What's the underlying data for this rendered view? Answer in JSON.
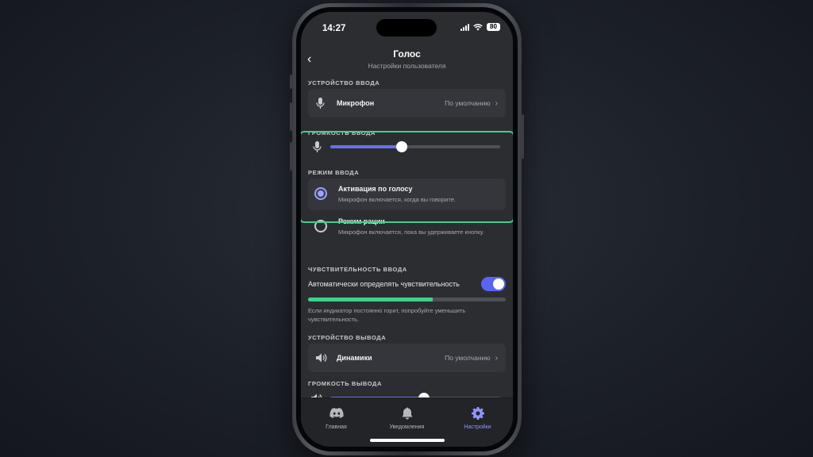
{
  "status_bar": {
    "time": "14:27",
    "battery": "80"
  },
  "header": {
    "title": "Голос",
    "subtitle": "Настройки пользователя"
  },
  "input_device": {
    "section_label": "УСТРОЙСТВО ВВОДА",
    "label": "Микрофон",
    "value": "По умолчанию",
    "icon": "microphone-icon"
  },
  "input_volume": {
    "section_label": "ГРОМКОСТЬ ВВОДА",
    "level": 0.42,
    "icon": "microphone-icon"
  },
  "input_mode": {
    "section_label": "РЕЖИМ ВВОДА",
    "options": [
      {
        "title": "Активация по голосу",
        "description": "Микрофон включается, когда вы говорите.",
        "selected": true
      },
      {
        "title": "Режим рации",
        "description": "Микрофон включается, пока вы удерживаете кнопку.",
        "selected": false
      }
    ],
    "highlight_color": "#3bd28a"
  },
  "input_sensitivity": {
    "section_label": "ЧУВСТВИТЕЛЬНОСТЬ ВВОДА",
    "toggle_label": "Автоматически определять чувствительность",
    "toggle_on": true,
    "level": 0.63,
    "hint": "Если индикатор постоянно горит, попробуйте уменьшить чувствительность."
  },
  "output_device": {
    "section_label": "УСТРОЙСТВО ВЫВОДА",
    "label": "Динамики",
    "value": "По умолчанию",
    "icon": "speaker-icon"
  },
  "output_volume": {
    "section_label": "ГРОМКОСТЬ ВЫВОДА",
    "level": 0.55,
    "icon": "speaker-icon"
  },
  "tabbar": {
    "tabs": [
      {
        "label": "Главная",
        "icon": "discord-logo-icon",
        "active": false
      },
      {
        "label": "Уведомления",
        "icon": "bell-icon",
        "active": false
      },
      {
        "label": "Настройки",
        "icon": "gear-icon",
        "active": true
      }
    ]
  },
  "colors": {
    "accent": "#5865f2",
    "accent_light": "#8e96ff",
    "green": "#3bd28a",
    "background": "#2b2d31"
  }
}
